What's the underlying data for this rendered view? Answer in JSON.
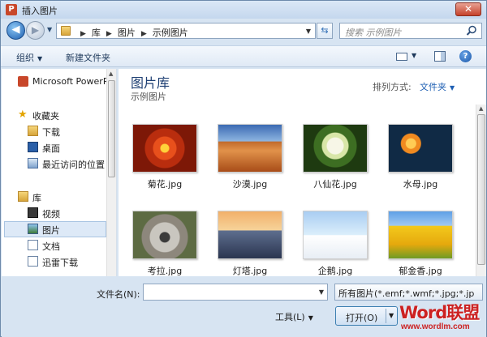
{
  "window": {
    "title": "插入图片",
    "close_glyph": "✕",
    "app_icon_letter": "P"
  },
  "nav": {
    "back_glyph": "◀",
    "forward_glyph": "▶",
    "breadcrumb": [
      "库",
      "图片",
      "示例图片"
    ],
    "search_placeholder": "搜索 示例图片"
  },
  "toolbar": {
    "organize_label": "组织",
    "new_folder_label": "新建文件夹",
    "help_glyph": "?"
  },
  "sidebar": {
    "items": [
      {
        "label": "Microsoft PowerPoint",
        "icon": "powerpoint-icon"
      },
      {
        "label": "收藏夹",
        "icon": "star-icon"
      },
      {
        "label": "下载",
        "icon": "download-folder-icon"
      },
      {
        "label": "桌面",
        "icon": "desktop-icon"
      },
      {
        "label": "最近访问的位置",
        "icon": "recent-places-icon"
      },
      {
        "label": "库",
        "icon": "library-icon"
      },
      {
        "label": "视频",
        "icon": "videos-icon"
      },
      {
        "label": "图片",
        "icon": "pictures-icon"
      },
      {
        "label": "文档",
        "icon": "documents-icon"
      },
      {
        "label": "迅雷下载",
        "icon": "thunder-download-icon"
      }
    ],
    "selected": "图片"
  },
  "main": {
    "library_title": "图片库",
    "library_subtitle": "示例图片",
    "arrange_label": "排列方式:",
    "arrange_value": "文件夹",
    "files": [
      {
        "name": "菊花.jpg"
      },
      {
        "name": "沙漠.jpg"
      },
      {
        "name": "八仙花.jpg"
      },
      {
        "name": "水母.jpg"
      },
      {
        "name": "考拉.jpg"
      },
      {
        "name": "灯塔.jpg"
      },
      {
        "name": "企鹅.jpg"
      },
      {
        "name": "郁金香.jpg"
      }
    ]
  },
  "footer": {
    "filename_label": "文件名(N):",
    "filename_value": "",
    "filetype_value": "所有图片(*.emf;*.wmf;*.jpg;*.jp",
    "tools_label": "工具(L)",
    "open_label": "打开(O)"
  },
  "watermark": {
    "logo": "Word联盟",
    "url": "www.wordlm.com"
  }
}
